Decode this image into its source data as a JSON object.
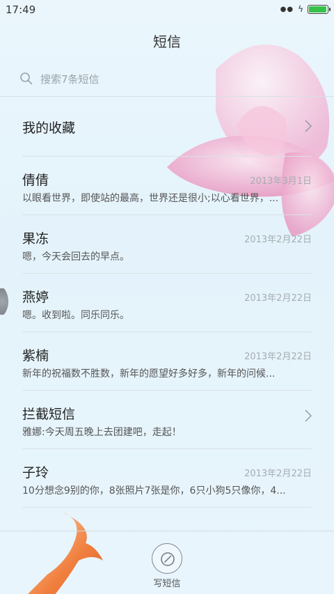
{
  "status": {
    "time": "17:49",
    "signal_icon": "signal-dots-icon",
    "charging_icon": "charging-bolt-icon",
    "battery_level": 0.95
  },
  "header": {
    "title": "短信"
  },
  "search": {
    "placeholder": "搜索7条短信",
    "icon": "search-icon"
  },
  "favorites": {
    "label": "我的收藏"
  },
  "conversations": [
    {
      "name": "倩倩",
      "date": "2013年3月1日",
      "preview": "以眼看世界，即使站的最高，世界还是很小;以心看世界，..."
    },
    {
      "name": "果冻",
      "date": "2013年2月22日",
      "preview": "嗯，今天会回去的早点。"
    },
    {
      "name": "燕婷",
      "date": "2013年2月22日",
      "preview": "嗯。收到啦。同乐同乐。"
    },
    {
      "name": "紫楠",
      "date": "2013年2月22日",
      "preview": "新年的祝福数不胜数，新年的愿望好多好多，新年的问候..."
    },
    {
      "name": "拦截短信",
      "date": "",
      "preview": "雅娜:今天周五晚上去团建吧，走起！"
    },
    {
      "name": "子玲",
      "date": "2013年2月22日",
      "preview": "10分想念9别的你，8张照片7张是你，6只小狗5只像你，4..."
    }
  ],
  "compose": {
    "label": "写短信",
    "icon": "compose-icon"
  },
  "colors": {
    "background": "#e4f3fb",
    "battery": "#36c24a",
    "lotus": "#f3b6d6"
  }
}
